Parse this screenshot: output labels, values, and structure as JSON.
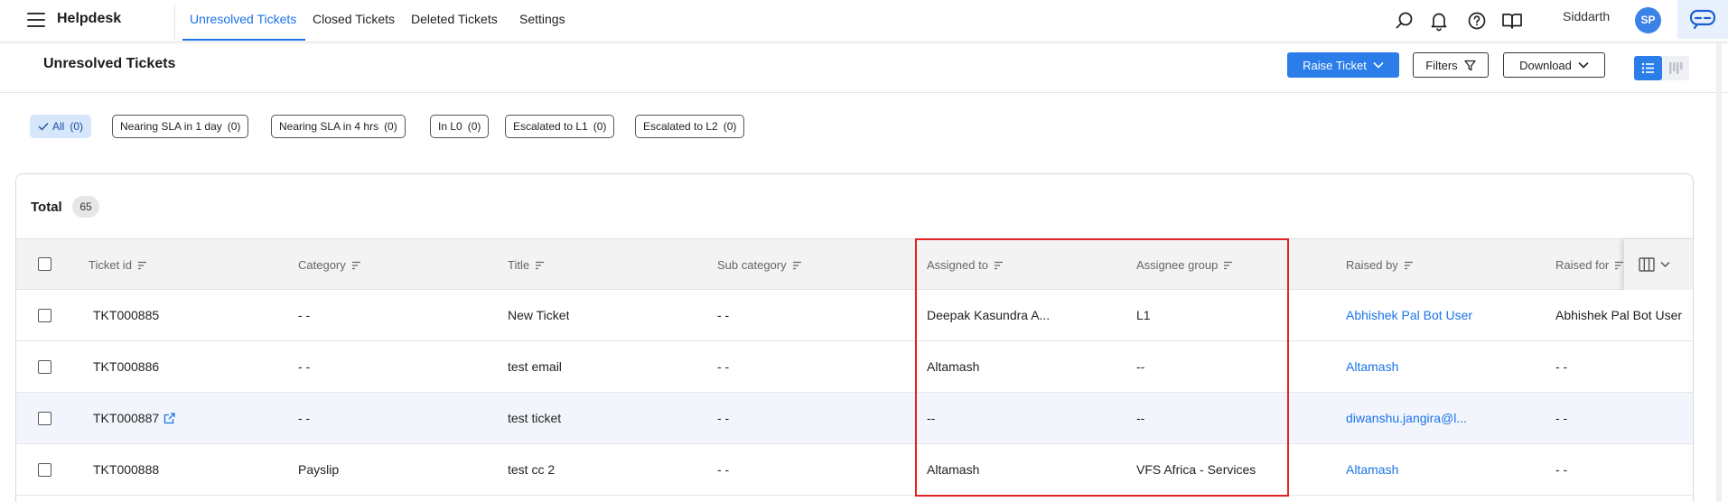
{
  "app": {
    "brand": "Helpdesk"
  },
  "nav": {
    "tabs": [
      {
        "label": "Unresolved Tickets",
        "active": true
      },
      {
        "label": "Closed Tickets",
        "active": false
      },
      {
        "label": "Deleted Tickets",
        "active": false
      },
      {
        "label": "Settings",
        "active": false
      }
    ]
  },
  "user": {
    "name": "Siddarth",
    "initials": "SP"
  },
  "page": {
    "title": "Unresolved Tickets"
  },
  "actions": {
    "raise_ticket": "Raise Ticket",
    "filters": "Filters",
    "download": "Download"
  },
  "filters": [
    {
      "label": "All",
      "count": "(0)",
      "active": true
    },
    {
      "label": "Nearing SLA in 1 day",
      "count": "(0)",
      "active": false
    },
    {
      "label": "Nearing SLA in 4 hrs",
      "count": "(0)",
      "active": false
    },
    {
      "label": "In L0",
      "count": "(0)",
      "active": false
    },
    {
      "label": "Escalated to L1",
      "count": "(0)",
      "active": false
    },
    {
      "label": "Escalated to L2",
      "count": "(0)",
      "active": false
    }
  ],
  "table": {
    "total_label": "Total",
    "total_count": "65",
    "columns": [
      "Ticket id",
      "Category",
      "Title",
      "Sub category",
      "Assigned to",
      "Assignee group",
      "Raised by",
      "Raised for"
    ],
    "rows": [
      {
        "ticket_id": "TKT000885",
        "category": "- -",
        "title": "New Ticket",
        "sub_category": "- -",
        "assigned_to": "Deepak Kasundra A...",
        "assignee_group": "L1",
        "raised_by": "Abhishek Pal Bot User",
        "raised_for": "Abhishek Pal Bot User"
      },
      {
        "ticket_id": "TKT000886",
        "category": "- -",
        "title": "test email",
        "sub_category": "- -",
        "assigned_to": "Altamash",
        "assignee_group": "--",
        "raised_by": "Altamash",
        "raised_for": "- -"
      },
      {
        "ticket_id": "TKT000887",
        "category": "- -",
        "title": "test ticket",
        "sub_category": "- -",
        "assigned_to": "--",
        "assignee_group": "--",
        "raised_by": "diwanshu.jangira@l...",
        "raised_for": "- -"
      },
      {
        "ticket_id": "TKT000888",
        "category": "Payslip",
        "title": "test cc 2",
        "sub_category": "- -",
        "assigned_to": "Altamash",
        "assignee_group": "VFS Africa - Services",
        "raised_by": "Altamash",
        "raised_for": "- -"
      }
    ]
  },
  "icons": {
    "menu": "hamburger-menu-icon",
    "search": "search-icon",
    "notifications": "bell-icon",
    "help": "help-icon",
    "docs": "book-icon",
    "external": "external-link-icon"
  },
  "colors": {
    "accent": "#1a73e8",
    "primary_button": "#2b7de9",
    "highlight_box": "#e02424"
  }
}
